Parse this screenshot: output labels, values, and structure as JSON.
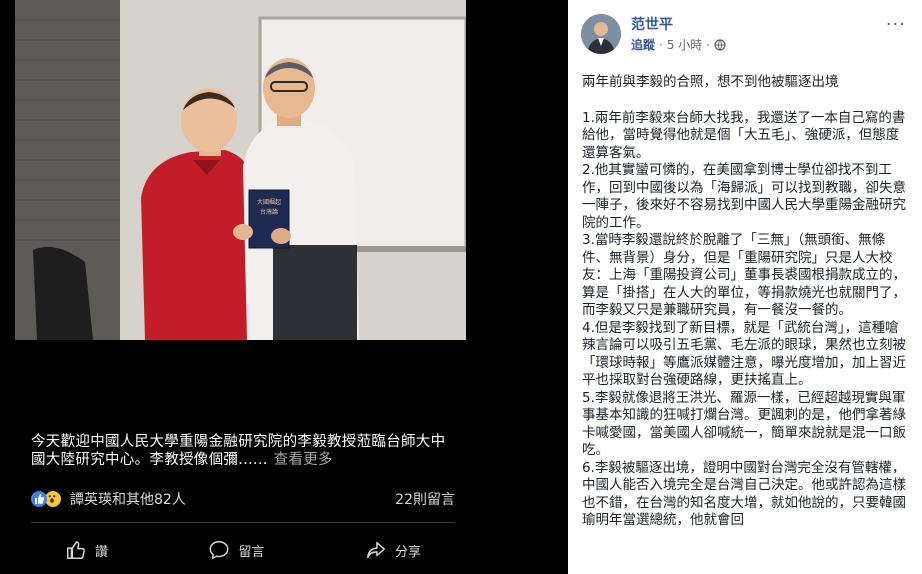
{
  "photo_panel": {
    "book_title_text": "大國崛起台灣論",
    "caption_text": "今天歡迎中國人民大學重陽金融研究院的李毅教授蒞臨台師大中國大陸研究中心。李教授像個彌......",
    "see_more": "查看更多",
    "reactions_summary": "譚英瑛和其他82人",
    "comments_count": "22則留言",
    "actions": {
      "like": "讚",
      "comment": "留言",
      "share": "分享"
    }
  },
  "post": {
    "author": "范世平",
    "follow": "追蹤",
    "meta_sep": "·",
    "time": "5 小時",
    "more": "···",
    "lead": "兩年前與李毅的合照，想不到他被驅逐出境",
    "paragraphs": [
      "1.兩年前李毅來台師大找我，我還送了一本自己寫的書給他，當時覺得他就是個「大五毛」、強硬派，但態度還算客氣。",
      "2.他其實蠻可憐的，在美國拿到博士學位卻找不到工作，回到中國後以為「海歸派」可以找到教職，卻失意一陣子，後來好不容易找到中國人民大學重陽金融研究院的工作。",
      "3.當時李毅還說終於脫離了「三無」（無頭銜、無條件、無背景）身分，但是「重陽研究院」只是人大校友：上海「重陽投資公司」董事長裘國根捐款成立的，算是「掛搭」在人大的單位，等捐款燒光也就關門了，而李毅又只是兼職研究員，有一餐沒一餐的。",
      "4.但是李毅找到了新目標，就是「武統台灣」，這種嗆辣言論可以吸引五毛黨、毛左派的眼球，果然也立刻被「環球時報」等鷹派媒體注意，曝光度增加，加上習近平也採取對台強硬路線，更扶搖直上。",
      "5.李毅就像退將王洪光、羅源一樣，已經超越現實與軍事基本知識的狂喊打爛台灣。更諷刺的是，他們拿著綠卡喊愛國，當美國人卻喊統一，簡單來說就是混一口飯吃。",
      "6.李毅被驅逐出境，證明中國對台灣完全沒有管轄權，中國人能否入境完全是台灣自己決定。他或許認為這樣也不錯，在台灣的知名度大增，就如他說的，只要韓國瑜明年當選總統，他就會回"
    ]
  },
  "colors": {
    "link_blue": "#385898",
    "like_blue": "#3b82f0",
    "wow_yellow": "#f7c934",
    "text_dark": "#1d2129",
    "meta_gray": "#616770"
  },
  "icons": [
    "like-reaction-icon",
    "wow-reaction-icon",
    "thumbs-up-icon",
    "comment-bubble-icon",
    "share-arrow-icon",
    "globe-icon",
    "more-options-icon"
  ]
}
